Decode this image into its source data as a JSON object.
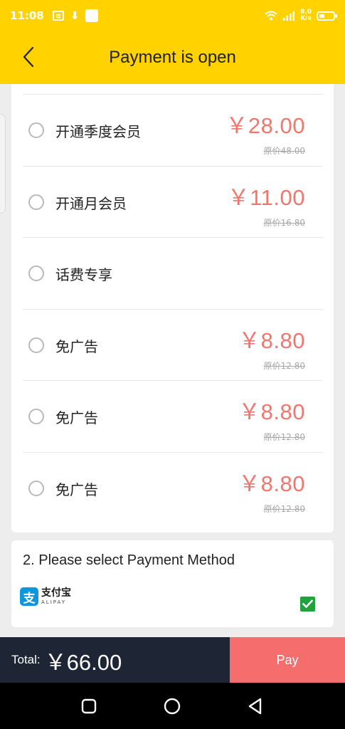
{
  "status_bar": {
    "time": "11:08",
    "net_speed_value": "8.0",
    "net_speed_unit": "K/s",
    "battery_level": 0.4
  },
  "header": {
    "title": "Payment is open",
    "back_icon": "chevron-left-icon"
  },
  "plans": [
    {
      "name": "开通季度会员",
      "price": "￥28.00",
      "original": "原价48.00"
    },
    {
      "name": "开通月会员",
      "price": "￥11.00",
      "original": "原价16.80"
    },
    {
      "name": "话费专享",
      "price": "",
      "original": ""
    },
    {
      "name": "免广告",
      "price": "￥8.80",
      "original": "原价12.80"
    },
    {
      "name": "免广告",
      "price": "￥8.80",
      "original": "原价12.80"
    },
    {
      "name": "免广告",
      "price": "￥8.80",
      "original": "原价12.80"
    }
  ],
  "payment": {
    "heading": "2. Please select Payment Method",
    "method_cn": "支付宝",
    "method_en": "ALIPAY",
    "method_mark": "支",
    "selected": true
  },
  "footer": {
    "total_label": "Total:",
    "total_amount": "￥66.00",
    "pay_label": "Pay"
  },
  "colors": {
    "brand_yellow": "#ffd200",
    "price_red": "#f2766c",
    "pay_button": "#f56d6d",
    "footer_dark": "#1e2636",
    "check_green": "#1fa33a",
    "alipay_blue": "#1296db"
  }
}
